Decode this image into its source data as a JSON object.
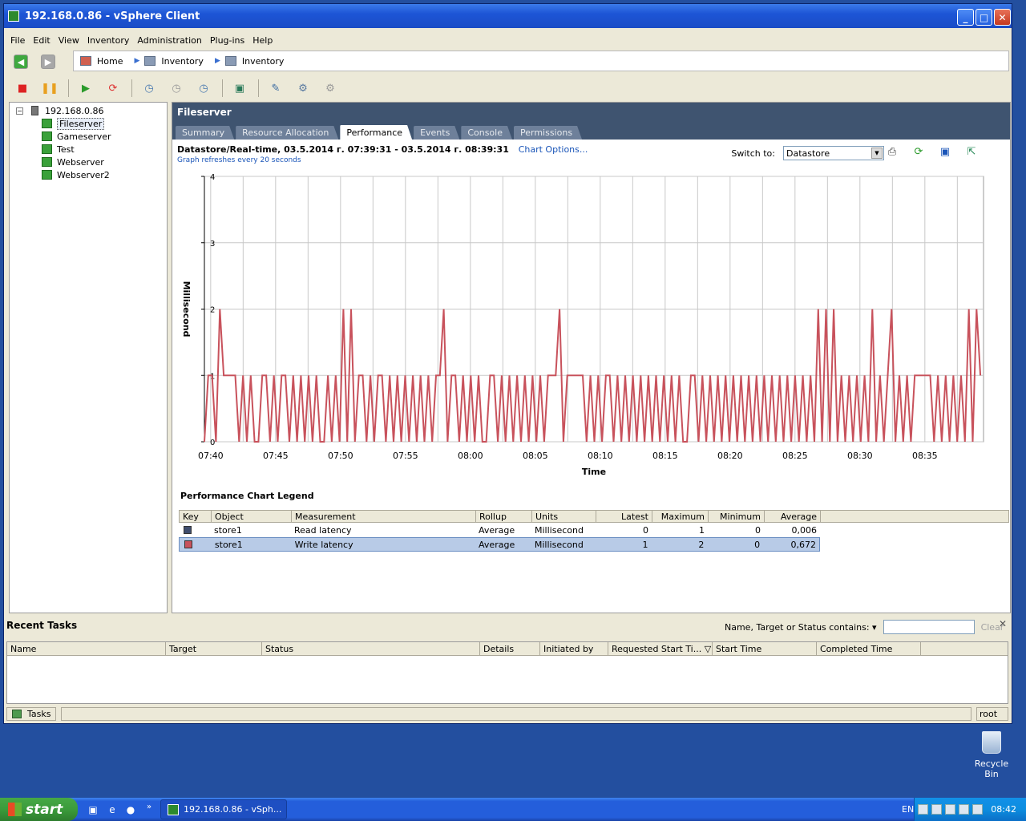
{
  "window": {
    "title": "192.168.0.86 - vSphere Client"
  },
  "menu": [
    "File",
    "Edit",
    "View",
    "Inventory",
    "Administration",
    "Plug-ins",
    "Help"
  ],
  "breadcrumb": [
    "Home",
    "Inventory",
    "Inventory"
  ],
  "tree": {
    "host": "192.168.0.86",
    "vms": [
      "Fileserver",
      "Gameserver",
      "Test",
      "Webserver",
      "Webserver2"
    ],
    "selected": "Fileserver"
  },
  "panel": {
    "title": "Fileserver",
    "tabs": [
      "Summary",
      "Resource Allocation",
      "Performance",
      "Events",
      "Console",
      "Permissions"
    ],
    "active_tab": "Performance",
    "chart_heading": "Datastore/Real-time, 03.5.2014 г. 07:39:31 - 03.5.2014 г. 08:39:31",
    "chart_options": "Chart Options...",
    "refresh_note": "Graph refreshes every 20 seconds",
    "switch_label": "Switch to:",
    "switch_value": "Datastore"
  },
  "chart_data": {
    "type": "line",
    "xlabel": "Time",
    "ylabel": "Millisecond",
    "ylim": [
      0,
      4
    ],
    "yticks": [
      "0",
      "1",
      "2",
      "3",
      "4"
    ],
    "xticks": [
      "07:40",
      "07:45",
      "07:50",
      "07:55",
      "08:00",
      "08:05",
      "08:10",
      "08:15",
      "08:20",
      "08:25",
      "08:30",
      "08:35"
    ],
    "x_start": "07:39:31",
    "x_end": "08:39:31",
    "interval_seconds": 20,
    "grid": true,
    "series": [
      {
        "name": "Write latency",
        "color": "#c8525c",
        "values": [
          0,
          1,
          1,
          0,
          2,
          1,
          1,
          1,
          1,
          0,
          1,
          0,
          1,
          0,
          0,
          1,
          1,
          0,
          1,
          0,
          1,
          1,
          0,
          1,
          0,
          1,
          0,
          1,
          0,
          1,
          0,
          0,
          1,
          0,
          1,
          0,
          2,
          0,
          2,
          0,
          1,
          1,
          0,
          1,
          0,
          1,
          1,
          0,
          1,
          0,
          1,
          0,
          1,
          0,
          1,
          0,
          1,
          0,
          1,
          0,
          1,
          1,
          2,
          0,
          1,
          1,
          0,
          1,
          0,
          1,
          0,
          1,
          0,
          0,
          1,
          1,
          0,
          1,
          0,
          1,
          0,
          1,
          0,
          1,
          0,
          1,
          0,
          1,
          0,
          1,
          1,
          1,
          2,
          0,
          1,
          1,
          1,
          1,
          1,
          0,
          1,
          0,
          1,
          0,
          1,
          1,
          0,
          1,
          0,
          1,
          0,
          1,
          0,
          1,
          0,
          1,
          0,
          1,
          0,
          1,
          0,
          1,
          0,
          1,
          0,
          0,
          1,
          1,
          0,
          1,
          0,
          1,
          0,
          1,
          0,
          1,
          0,
          1,
          0,
          1,
          0,
          1,
          0,
          1,
          0,
          1,
          0,
          1,
          0,
          1,
          0,
          1,
          0,
          1,
          0,
          1,
          0,
          1,
          0,
          2,
          0,
          2,
          0,
          2,
          0,
          1,
          0,
          1,
          0,
          1,
          0,
          1,
          0,
          2,
          0,
          1,
          0,
          1,
          2,
          0,
          1,
          0,
          1,
          0,
          1,
          1,
          1,
          1,
          1,
          0,
          1,
          0,
          1,
          0,
          1,
          0,
          1,
          0,
          2,
          0,
          2,
          1
        ]
      },
      {
        "name": "Read latency",
        "color": "#3f4d6d",
        "values": [
          0
        ]
      }
    ]
  },
  "legend": {
    "title": "Performance Chart Legend",
    "headers": [
      "Key",
      "Object",
      "Measurement",
      "Rollup",
      "Units",
      "Latest",
      "Maximum",
      "Minimum",
      "Average"
    ],
    "rows": [
      {
        "color": "#3f4d6d",
        "object": "store1",
        "measurement": "Read latency",
        "rollup": "Average",
        "units": "Millisecond",
        "latest": "0",
        "maximum": "1",
        "minimum": "0",
        "average": "0,006"
      },
      {
        "color": "#c8525c",
        "object": "store1",
        "measurement": "Write latency",
        "rollup": "Average",
        "units": "Millisecond",
        "latest": "1",
        "maximum": "2",
        "minimum": "0",
        "average": "0,672"
      }
    ]
  },
  "tasks": {
    "title": "Recent Tasks",
    "filter_label": "Name, Target or Status contains: ▾",
    "filter_value": "",
    "clear": "Clear",
    "headers": [
      "Name",
      "Target",
      "Status",
      "Details",
      "Initiated by",
      "Requested Start Ti... ▽",
      "Start Time",
      "Completed Time"
    ]
  },
  "status": {
    "tasks_label": "Tasks",
    "user": "root"
  },
  "desktop": {
    "recycle_bin": "Recycle Bin"
  },
  "taskbar": {
    "start": "start",
    "item": "192.168.0.86 - vSph...",
    "lang": "EN",
    "clock": "08:42"
  }
}
